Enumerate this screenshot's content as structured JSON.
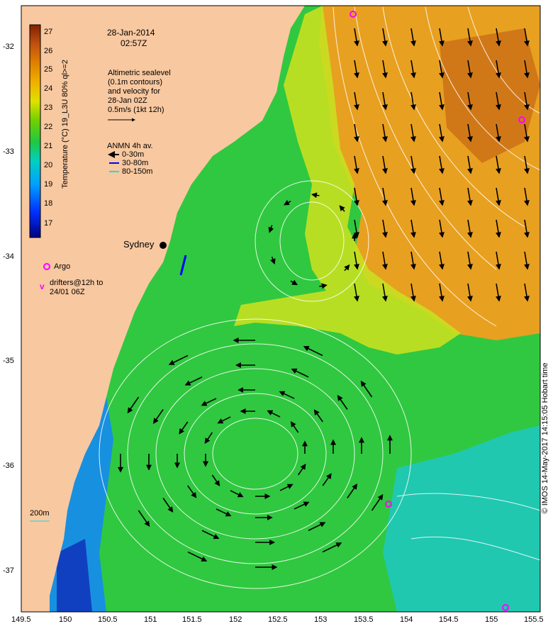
{
  "map": {
    "date": "28-Jan-2014",
    "time": "02:57Z",
    "altimetry_note": [
      "Altimetric sealevel",
      "(0.1m contours)",
      "and velocity for",
      "28-Jan 02Z",
      "0.5m/s (1kt 12h)"
    ],
    "anmn_title": "ANMN 4h av.",
    "anmn_legend": [
      {
        "label": "0-30m",
        "color": "#000000"
      },
      {
        "label": "30-80m",
        "color": "#0000ff"
      },
      {
        "label": "80-150m",
        "color": "#00e5e5"
      }
    ],
    "place_label": "Sydney",
    "argo_label": "Argo",
    "drifter_label": [
      "drifters@12h to",
      "24/01 06Z"
    ],
    "drifter_marker": "v",
    "contour_label": "200m",
    "credit": "© IMOS 14-May-2017 14:15:05 Hobart time",
    "colorbar": {
      "title": "Temperature (°C) 19_L3U 80% ql>=2",
      "ticks": [
        "17",
        "18",
        "19",
        "20",
        "21",
        "22",
        "23",
        "24",
        "25",
        "26",
        "27"
      ],
      "range": [
        16.5,
        27.5
      ]
    },
    "lon_ticks": [
      "149.5",
      "150",
      "150.5",
      "151",
      "151.5",
      "152",
      "152.5",
      "153",
      "153.5",
      "154",
      "154.5",
      "155",
      "155.5"
    ],
    "lat_ticks": [
      "-32",
      "-33",
      "-34",
      "-35",
      "-36",
      "-37"
    ],
    "colors": {
      "land": "#f8c8a0",
      "argo": "#ff00ff",
      "warm": "#e8a020",
      "cool": "#30c840"
    }
  }
}
